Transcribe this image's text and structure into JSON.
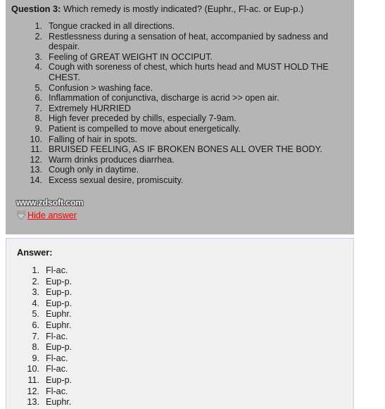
{
  "question": {
    "label": "Question 3:",
    "prompt": " Which remedy is mostly indicated? (Euphr., Fl-ac. or Eup-p.)",
    "items": [
      "Tongue cracked in all directions.",
      "Restlessness during a sensation of heat, accompanied by sadness and despair.",
      "Feeling of GREAT WEIGHT IN OCCIPUT.",
      "Cough with soreness of chest, which hurts head and MUST HOLD THE CHEST.",
      "Confusion > washing face.",
      "Inflammation of conjunctiva, discharge is acrid >> open air.",
      "Extremely HURRIED",
      "High fever preceded by chills, especially 7-9am.",
      "Patient is compelled to move about energetically.",
      "Falling of hair in spots.",
      "BRUISED FEELING, AS IF BROKEN BONES ALL OVER THE BODY.",
      "Warm drinks produces diarrhea.",
      "Cough only in daytime.",
      "Excess sexual desire, promiscuity."
    ]
  },
  "watermark": {
    "text": "www.zdsoft.com"
  },
  "toggle": {
    "label": "Hide answer",
    "icon": "arrow-down-icon",
    "link_color": "#ff0000"
  },
  "answer": {
    "title": "Answer:",
    "items": [
      "Fl-ac.",
      "Eup-p.",
      "Eup-p.",
      "Eup-p.",
      "Euphr.",
      "Euphr.",
      "Fl-ac.",
      "Eup-p.",
      "Fl-ac.",
      "Fl-ac.",
      "Eup-p.",
      "Fl-ac.",
      "Euphr."
    ]
  },
  "colors": {
    "question_panel_bg": "#b5b5b5",
    "answer_panel_bg": "#f0f0f0",
    "answer_panel_border": "#ccccee",
    "page_bg": "#ffffff",
    "text": "#171717",
    "link": "#ff0000"
  }
}
